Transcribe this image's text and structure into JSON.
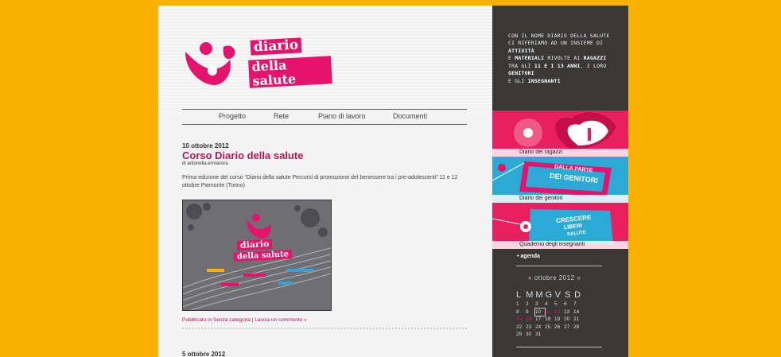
{
  "logo": {
    "word1": "diario",
    "word2": "della salute"
  },
  "nav": [
    "Progetto",
    "Rete",
    "Piano di lavoro",
    "Documenti"
  ],
  "post": {
    "date": "10 ottobre 2012",
    "title": "Corso Diario della salute",
    "author": "di antonella.ermacora",
    "excerpt": "Prima edizione del corso “Diario della salute Percorsi di promozione del benessere tra i pre-adolescenti” 11 e 12 ottobre Piemonte (Torino)",
    "thumb": {
      "word1": "diario",
      "word2": "della salute"
    },
    "meta": "Pubblicato in Senza categoria | Lascia un commento »"
  },
  "post2": {
    "date": "5 ottobre 2012"
  },
  "sidebar": {
    "intro": [
      "Con il nome Diario della Salute",
      "ci riferiamo ad un insieme di",
      "attività",
      "e",
      "materiali",
      "rivolte ai",
      "ragazzi",
      "tra gli",
      "11 e i 13 anni",
      ", i loro",
      "genitori",
      "e gli",
      "insegnanti"
    ],
    "banners": [
      {
        "label": "Diario dei ragazzi",
        "art": "love-heart-art"
      },
      {
        "label": "Diario dei genitori",
        "art": "genitori-heart-art",
        "text1": "DALLA PARTE",
        "text2": "DEI GENITORI"
      },
      {
        "label": "Quaderno degli Insegnanti",
        "art": "insegnanti-heart-art",
        "text1": "CRESCERE",
        "text2": "LIBERI",
        "text3": "SALUTE"
      }
    ],
    "agenda": "• agenda",
    "calendar": {
      "header": "« ottobre 2012 »",
      "dow": [
        "L",
        "M",
        "M",
        "G",
        "V",
        "S",
        "D"
      ],
      "weeks": [
        [
          "1",
          "2",
          "3",
          "4",
          "5",
          "6",
          "7"
        ],
        [
          "8",
          "9",
          "10",
          "11",
          "12",
          "13",
          "14"
        ],
        [
          "15",
          "16",
          "17",
          "18",
          "19",
          "20",
          "21"
        ],
        [
          "22",
          "23",
          "24",
          "25",
          "26",
          "27",
          "28"
        ],
        [
          "29",
          "30",
          "31",
          "",
          "",
          "",
          ""
        ]
      ],
      "today": "10",
      "event_days": [
        "11",
        "12",
        "15",
        "16"
      ]
    }
  },
  "colors": {
    "background": "#f9b200",
    "accent": "#e6136c",
    "sidebar": "#3a3837"
  }
}
